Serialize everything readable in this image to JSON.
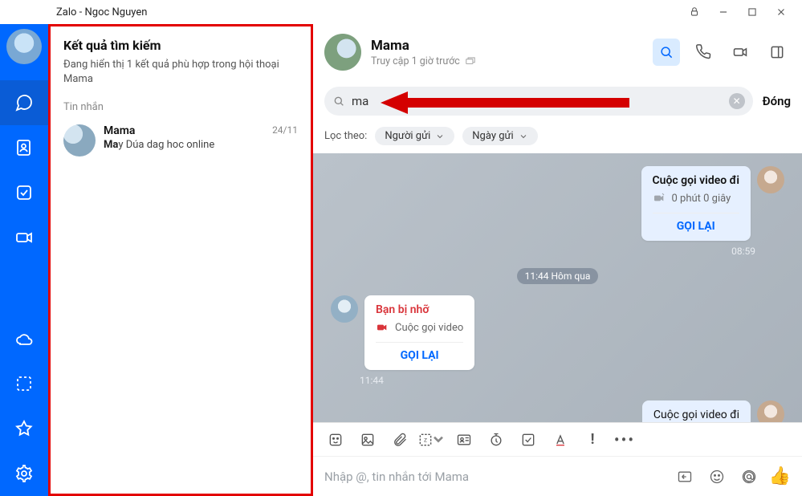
{
  "titlebar": {
    "app": "Zalo",
    "sep": "-",
    "user": "Ngoc Nguyen"
  },
  "results": {
    "heading": "Kết quả tìm kiếm",
    "sub": "Đang hiển thị 1 kết quả phù hợp trong hội thoại Mama",
    "section": "Tin nhắn",
    "items": [
      {
        "name": "Mama",
        "date": "24/11",
        "hl": "Ma",
        "rest": "y Dúa dag hoc online"
      }
    ]
  },
  "chat": {
    "header": {
      "name": "Mama",
      "status": "Truy cập 1 giờ trước"
    },
    "search": {
      "value": "ma",
      "close": "Đóng"
    },
    "filter": {
      "label": "Lọc theo:",
      "chip1": "Người gửi",
      "chip2": "Ngày gửi"
    },
    "msg1": {
      "title": "Cuộc gọi video đi",
      "meta": "0 phút 0 giây",
      "recall": "GỌI LẠI",
      "time": "08:59"
    },
    "pill1": "11:44 Hôm qua",
    "msg2": {
      "title": "Bạn bị nhỡ",
      "meta": "Cuộc gọi video",
      "recall": "GỌI LẠI",
      "time": "11:44"
    },
    "msg3": {
      "text": "Cuộc gọi video đi"
    },
    "composer_ph": "Nhập @, tin nhắn tới Mama"
  }
}
